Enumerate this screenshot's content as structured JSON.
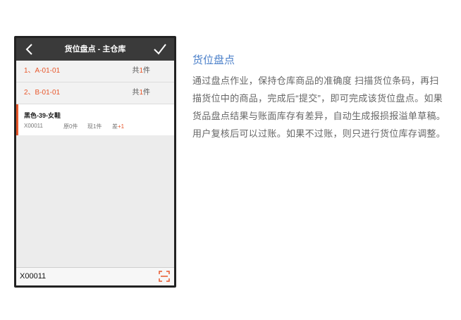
{
  "topbar": {
    "title": "货位盘点 - 主仓库",
    "back_icon": "chevron-left-icon",
    "confirm_icon": "checkmark-icon"
  },
  "locations": [
    {
      "code": "1、A-01-01",
      "count_prefix": "共",
      "count": "1",
      "count_suffix": "件"
    },
    {
      "code": "2、B-01-01",
      "count_prefix": "共",
      "count": "1",
      "count_suffix": "件"
    }
  ],
  "item": {
    "name": "黑色-39-女鞋",
    "sku": "X00011",
    "original": "原0件",
    "current": "现1件",
    "diff_label": "差",
    "diff_value": "+1"
  },
  "scan_bar": {
    "value": "X00011",
    "scan_icon": "scan-icon"
  },
  "description": {
    "title": "货位盘点",
    "text": "通过盘点作业，保持仓库商品的准确度 扫描货位条码，再扫描货位中的商品，完成后“提交”，即可完成该货位盘点。如果货品盘点结果与账面库存有差异，自动生成报损报溢单草稿。用户复核后可以过账。如果不过账，则只进行货位库存调整。"
  },
  "colors": {
    "accent": "#e8572b",
    "title_blue": "#4a7fc9",
    "topbar": "#3a3a3a"
  }
}
